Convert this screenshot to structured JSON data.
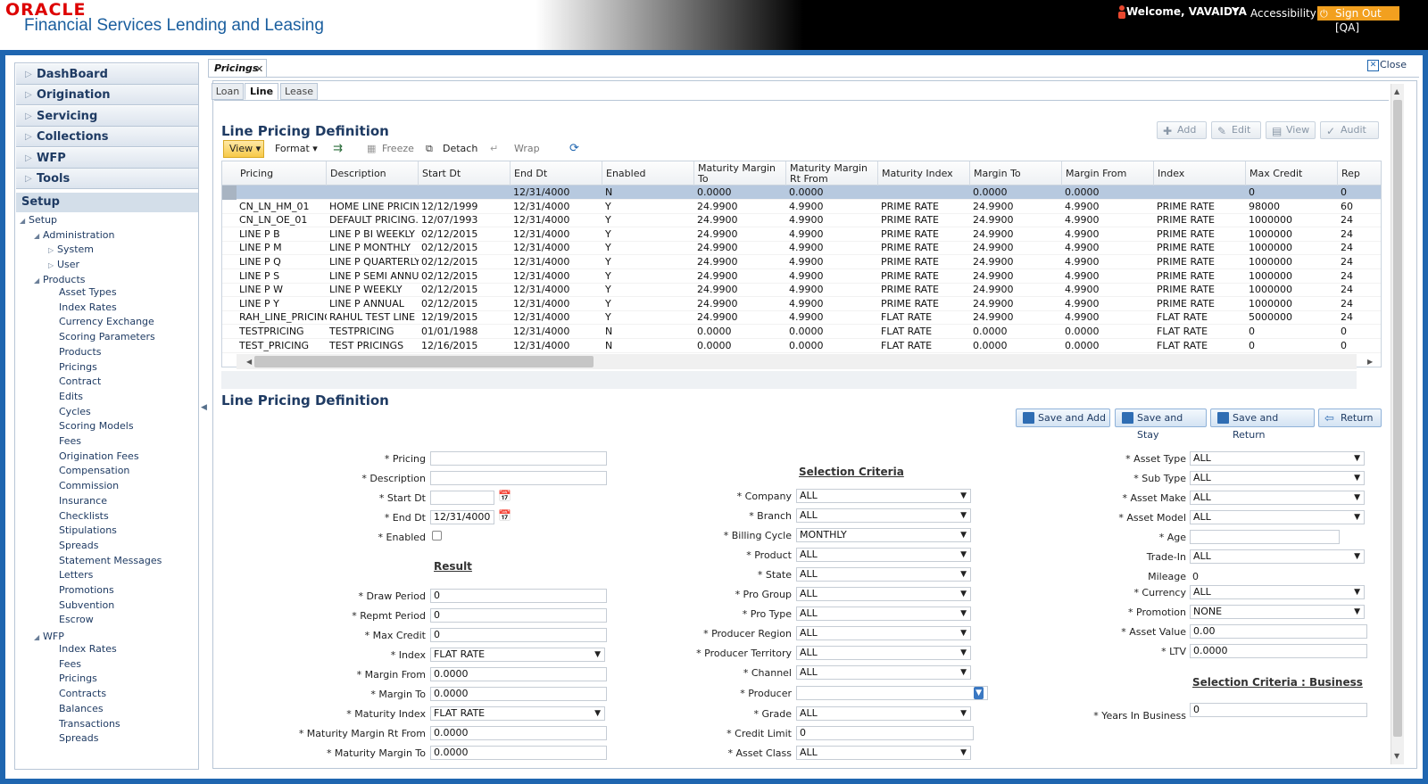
{
  "header": {
    "brand": "ORACLE",
    "product": "Financial Services Lending and Leasing",
    "welcome": "Welcome, VAVAIDYA",
    "accessibility": "Accessibility",
    "signout": "Sign Out [QA]"
  },
  "nav": {
    "sections": [
      "DashBoard",
      "Origination",
      "Servicing",
      "Collections",
      "WFP",
      "Tools"
    ],
    "setup_title": "Setup",
    "tree": {
      "root": "Setup",
      "administration": "Administration",
      "system": "System",
      "user": "User",
      "products": "Products",
      "product_items": [
        "Asset Types",
        "Index Rates",
        "Currency Exchange",
        "Scoring Parameters",
        "Products",
        "Pricings",
        "Contract",
        "Edits",
        "Cycles",
        "Scoring Models",
        "Fees",
        "Origination Fees",
        "Compensation",
        "Commission",
        "Insurance",
        "Checklists",
        "Stipulations",
        "Spreads",
        "Statement Messages",
        "Letters",
        "Promotions",
        "Subvention",
        "Escrow"
      ],
      "wfp": "WFP",
      "wfp_items": [
        "Index Rates",
        "Fees",
        "Pricings",
        "Contracts",
        "Balances",
        "Transactions",
        "Spreads"
      ]
    }
  },
  "page": {
    "tab": "Pricings",
    "close": "Close",
    "subtabs": [
      "Loan",
      "Line",
      "Lease"
    ]
  },
  "grid_section": {
    "title": "Line Pricing Definition",
    "buttons": {
      "add": "Add",
      "edit": "Edit",
      "view": "View",
      "audit": "Audit"
    },
    "toolbar": {
      "view": "View",
      "format": "Format",
      "freeze": "Freeze",
      "detach": "Detach",
      "wrap": "Wrap"
    },
    "columns": [
      "Pricing",
      "Description",
      "Start Dt",
      "End Dt",
      "Enabled",
      "Maturity Margin To",
      "Maturity Margin Rt From",
      "Maturity Index",
      "Margin To",
      "Margin From",
      "Index",
      "Max Credit",
      "Rep"
    ],
    "rows": [
      [
        "",
        "",
        "",
        "12/31/4000",
        "N",
        "0.0000",
        "0.0000",
        "",
        "0.0000",
        "0.0000",
        "",
        "0",
        "0"
      ],
      [
        "CN_LN_HM_01",
        "HOME LINE PRICING",
        "12/12/1999",
        "12/31/4000",
        "Y",
        "24.9900",
        "4.9900",
        "PRIME RATE",
        "24.9900",
        "4.9900",
        "PRIME RATE",
        "98000",
        "60"
      ],
      [
        "CN_LN_OE_01",
        "DEFAULT PRICING...",
        "12/07/1993",
        "12/31/4000",
        "Y",
        "24.9900",
        "4.9900",
        "PRIME RATE",
        "24.9900",
        "4.9900",
        "PRIME RATE",
        "1000000",
        "24"
      ],
      [
        "LINE P B",
        "LINE P BI WEEKLY",
        "02/12/2015",
        "12/31/4000",
        "Y",
        "24.9900",
        "4.9900",
        "PRIME RATE",
        "24.9900",
        "4.9900",
        "PRIME RATE",
        "1000000",
        "24"
      ],
      [
        "LINE P M",
        "LINE P MONTHLY",
        "02/12/2015",
        "12/31/4000",
        "Y",
        "24.9900",
        "4.9900",
        "PRIME RATE",
        "24.9900",
        "4.9900",
        "PRIME RATE",
        "1000000",
        "24"
      ],
      [
        "LINE P Q",
        "LINE P QUARTERLY",
        "02/12/2015",
        "12/31/4000",
        "Y",
        "24.9900",
        "4.9900",
        "PRIME RATE",
        "24.9900",
        "4.9900",
        "PRIME RATE",
        "1000000",
        "24"
      ],
      [
        "LINE P S",
        "LINE P SEMI ANNU...",
        "02/12/2015",
        "12/31/4000",
        "Y",
        "24.9900",
        "4.9900",
        "PRIME RATE",
        "24.9900",
        "4.9900",
        "PRIME RATE",
        "1000000",
        "24"
      ],
      [
        "LINE P W",
        "LINE P WEEKLY",
        "02/12/2015",
        "12/31/4000",
        "Y",
        "24.9900",
        "4.9900",
        "PRIME RATE",
        "24.9900",
        "4.9900",
        "PRIME RATE",
        "1000000",
        "24"
      ],
      [
        "LINE P Y",
        "LINE P ANNUAL",
        "02/12/2015",
        "12/31/4000",
        "Y",
        "24.9900",
        "4.9900",
        "PRIME RATE",
        "24.9900",
        "4.9900",
        "PRIME RATE",
        "1000000",
        "24"
      ],
      [
        "RAH_LINE_PRICING",
        "RAHUL TEST LINE ...",
        "12/19/2015",
        "12/31/4000",
        "Y",
        "24.9900",
        "4.9900",
        "FLAT RATE",
        "24.9900",
        "4.9900",
        "FLAT RATE",
        "5000000",
        "24"
      ],
      [
        "TESTPRICING",
        "TESTPRICING",
        "01/01/1988",
        "12/31/4000",
        "N",
        "0.0000",
        "0.0000",
        "FLAT RATE",
        "0.0000",
        "0.0000",
        "FLAT RATE",
        "0",
        "0"
      ],
      [
        "TEST_PRICING",
        "TEST PRICINGS",
        "12/16/2015",
        "12/31/4000",
        "N",
        "0.0000",
        "0.0000",
        "FLAT RATE",
        "0.0000",
        "0.0000",
        "FLAT RATE",
        "0",
        "0"
      ]
    ]
  },
  "form": {
    "title": "Line Pricing Definition",
    "buttons": {
      "save_add": "Save and Add",
      "save_stay": "Save and Stay",
      "save_return": "Save and Return",
      "return": "Return"
    },
    "left": {
      "pricing_label": "* Pricing",
      "pricing": "",
      "description_label": "* Description",
      "description": "",
      "start_dt_label": "* Start Dt",
      "start_dt": "",
      "end_dt_label": "* End Dt",
      "end_dt": "12/31/4000",
      "enabled_label": "* Enabled",
      "result_title": "Result",
      "draw_period_label": "* Draw Period",
      "draw_period": "0",
      "repmt_period_label": "* Repmt Period",
      "repmt_period": "0",
      "max_credit_label": "* Max Credit",
      "max_credit": "0",
      "index_label": "* Index",
      "index": "FLAT RATE",
      "margin_from_label": "* Margin From",
      "margin_from": "0.0000",
      "margin_to_label": "* Margin To",
      "margin_to": "0.0000",
      "maturity_index_label": "* Maturity Index",
      "maturity_index": "FLAT RATE",
      "mat_margin_rt_from_label": "* Maturity Margin Rt From",
      "mat_margin_rt_from": "0.0000",
      "mat_margin_to_label": "* Maturity Margin To",
      "mat_margin_to": "0.0000"
    },
    "middle": {
      "title": "Selection Criteria",
      "company_label": "* Company",
      "company": "ALL",
      "branch_label": "* Branch",
      "branch": "ALL",
      "billing_cycle_label": "* Billing Cycle",
      "billing_cycle": "MONTHLY",
      "product_label": "* Product",
      "product": "ALL",
      "state_label": "* State",
      "state": "ALL",
      "pro_group_label": "* Pro Group",
      "pro_group": "ALL",
      "pro_type_label": "* Pro Type",
      "pro_type": "ALL",
      "producer_region_label": "* Producer Region",
      "producer_region": "ALL",
      "producer_territory_label": "* Producer Territory",
      "producer_territory": "ALL",
      "channel_label": "* Channel",
      "channel": "ALL",
      "producer_label": "* Producer",
      "producer": "",
      "grade_label": "* Grade",
      "grade": "ALL",
      "credit_limit_label": "* Credit Limit",
      "credit_limit": "0",
      "asset_class_label": "* Asset Class",
      "asset_class": "ALL"
    },
    "right": {
      "asset_type_label": "* Asset Type",
      "asset_type": "ALL",
      "sub_type_label": "* Sub Type",
      "sub_type": "ALL",
      "asset_make_label": "* Asset Make",
      "asset_make": "ALL",
      "asset_model_label": "* Asset Model",
      "asset_model": "ALL",
      "age_label": "* Age",
      "age": "",
      "trade_in_label": "Trade-In",
      "trade_in": "ALL",
      "mileage_label": "Mileage",
      "mileage": "0",
      "currency_label": "* Currency",
      "currency": "ALL",
      "promotion_label": "* Promotion",
      "promotion": "NONE",
      "asset_value_label": "* Asset Value",
      "asset_value": "0.00",
      "ltv_label": "* LTV",
      "ltv": "0.0000",
      "business_title": "Selection Criteria : Business",
      "years_label": "* Years In Business",
      "years": "0"
    }
  }
}
